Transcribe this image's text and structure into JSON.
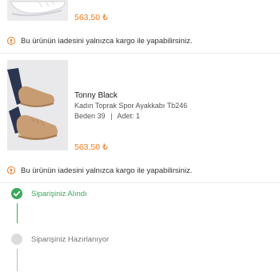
{
  "products": [
    {
      "price": "563,50 ₺",
      "return_notice": "Bu ürünün iadesini yalnızca kargo ile yapabilirsiniz."
    },
    {
      "brand": "Tonny Black",
      "name": "Kadın Toprak Spor Ayakkabı Tb246",
      "size_label": "Beden 39",
      "separator": "|",
      "quantity_label": "Adet: 1",
      "price": "563,50 ₺",
      "return_notice": "Bu ürünün iadesini yalnızca kargo ile yapabilirsiniz."
    }
  ],
  "order_steps": [
    {
      "label": "Siparişiniz Alındı",
      "status": "done",
      "color": "#3ca85c"
    },
    {
      "label": "Siparişiniz Hazırlanıyor",
      "status": "pending",
      "color": "#dcdcdc"
    }
  ],
  "colors": {
    "accent": "#f27a1a",
    "success": "#3ca85c"
  }
}
